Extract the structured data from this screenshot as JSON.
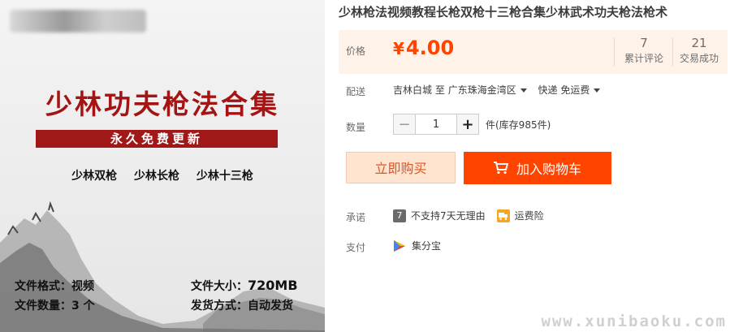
{
  "image": {
    "title": "少林功夫枪法合集",
    "banner": "永久免费更新",
    "items": [
      "少林双枪",
      "少林长枪",
      "少林十三枪"
    ],
    "file_format_label": "文件格式：",
    "file_format_value": "视频",
    "file_count_label": "文件数量：",
    "file_count_value": "3 个",
    "file_size_label": "文件大小：",
    "file_size_value": "720MB",
    "delivery_label": "发货方式：",
    "delivery_value": "自动发货"
  },
  "product": {
    "title": "少林枪法视频教程长枪双枪十三枪合集少林武术功夫枪法枪术"
  },
  "price": {
    "label": "价格",
    "symbol": "¥",
    "value": "4.00",
    "reviews_count": "7",
    "reviews_label": "累计评论",
    "sales_count": "21",
    "sales_label": "交易成功"
  },
  "shipping": {
    "label": "配送",
    "from": "吉林白城",
    "to_word": "至",
    "to": "广东珠海金湾区",
    "method": "快递 免运费"
  },
  "quantity": {
    "label": "数量",
    "minus": "−",
    "value": "1",
    "plus": "+",
    "stock": "件(库存985件)"
  },
  "buttons": {
    "buy_now": "立即购买",
    "add_to_cart": "加入购物车"
  },
  "promise": {
    "label": "承诺",
    "no_return": "不支持7天无理由",
    "no_return_icon": "7",
    "freight_insurance": "运费险"
  },
  "payment": {
    "label": "支付",
    "method": "集分宝"
  },
  "watermark": "www.xunibaoku.com",
  "colors": {
    "accent": "#ff4400",
    "price_bg": "#fff2e8",
    "title_red": "#a51414"
  }
}
